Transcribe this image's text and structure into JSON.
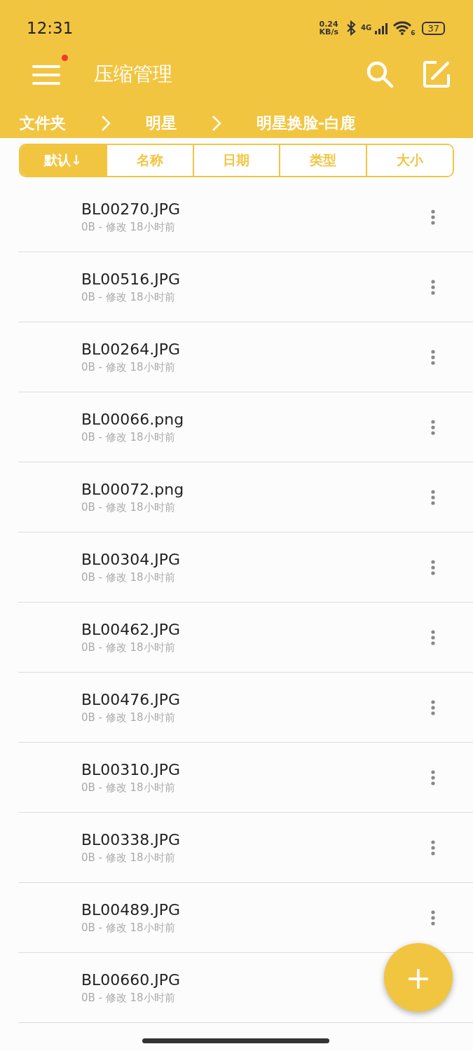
{
  "status_bar": {
    "time": "12:31",
    "speed_value": "0.24",
    "speed_unit": "KB/s",
    "network": "4G",
    "wifi_badge": "6",
    "battery": "37"
  },
  "app_bar": {
    "title": "压缩管理",
    "menu_badge": true
  },
  "breadcrumb": [
    {
      "label": "文件夹"
    },
    {
      "label": "明星"
    },
    {
      "label": "明星换脸-白鹿"
    }
  ],
  "sort_tabs": [
    {
      "label": "默认",
      "arrow": "↓",
      "selected": true
    },
    {
      "label": "名称",
      "selected": false
    },
    {
      "label": "日期",
      "selected": false
    },
    {
      "label": "类型",
      "selected": false
    },
    {
      "label": "大小",
      "selected": false
    }
  ],
  "files": [
    {
      "name": "BL00270.JPG",
      "meta": "0B - 修改 18小时前"
    },
    {
      "name": "BL00516.JPG",
      "meta": "0B - 修改 18小时前"
    },
    {
      "name": "BL00264.JPG",
      "meta": "0B - 修改 18小时前"
    },
    {
      "name": "BL00066.png",
      "meta": "0B - 修改 18小时前"
    },
    {
      "name": "BL00072.png",
      "meta": "0B - 修改 18小时前"
    },
    {
      "name": "BL00304.JPG",
      "meta": "0B - 修改 18小时前"
    },
    {
      "name": "BL00462.JPG",
      "meta": "0B - 修改 18小时前"
    },
    {
      "name": "BL00476.JPG",
      "meta": "0B - 修改 18小时前"
    },
    {
      "name": "BL00310.JPG",
      "meta": "0B - 修改 18小时前"
    },
    {
      "name": "BL00338.JPG",
      "meta": "0B - 修改 18小时前"
    },
    {
      "name": "BL00489.JPG",
      "meta": "0B - 修改 18小时前"
    },
    {
      "name": "BL00660.JPG",
      "meta": "0B - 修改 18小时前"
    }
  ],
  "fab": {
    "label": "+"
  }
}
